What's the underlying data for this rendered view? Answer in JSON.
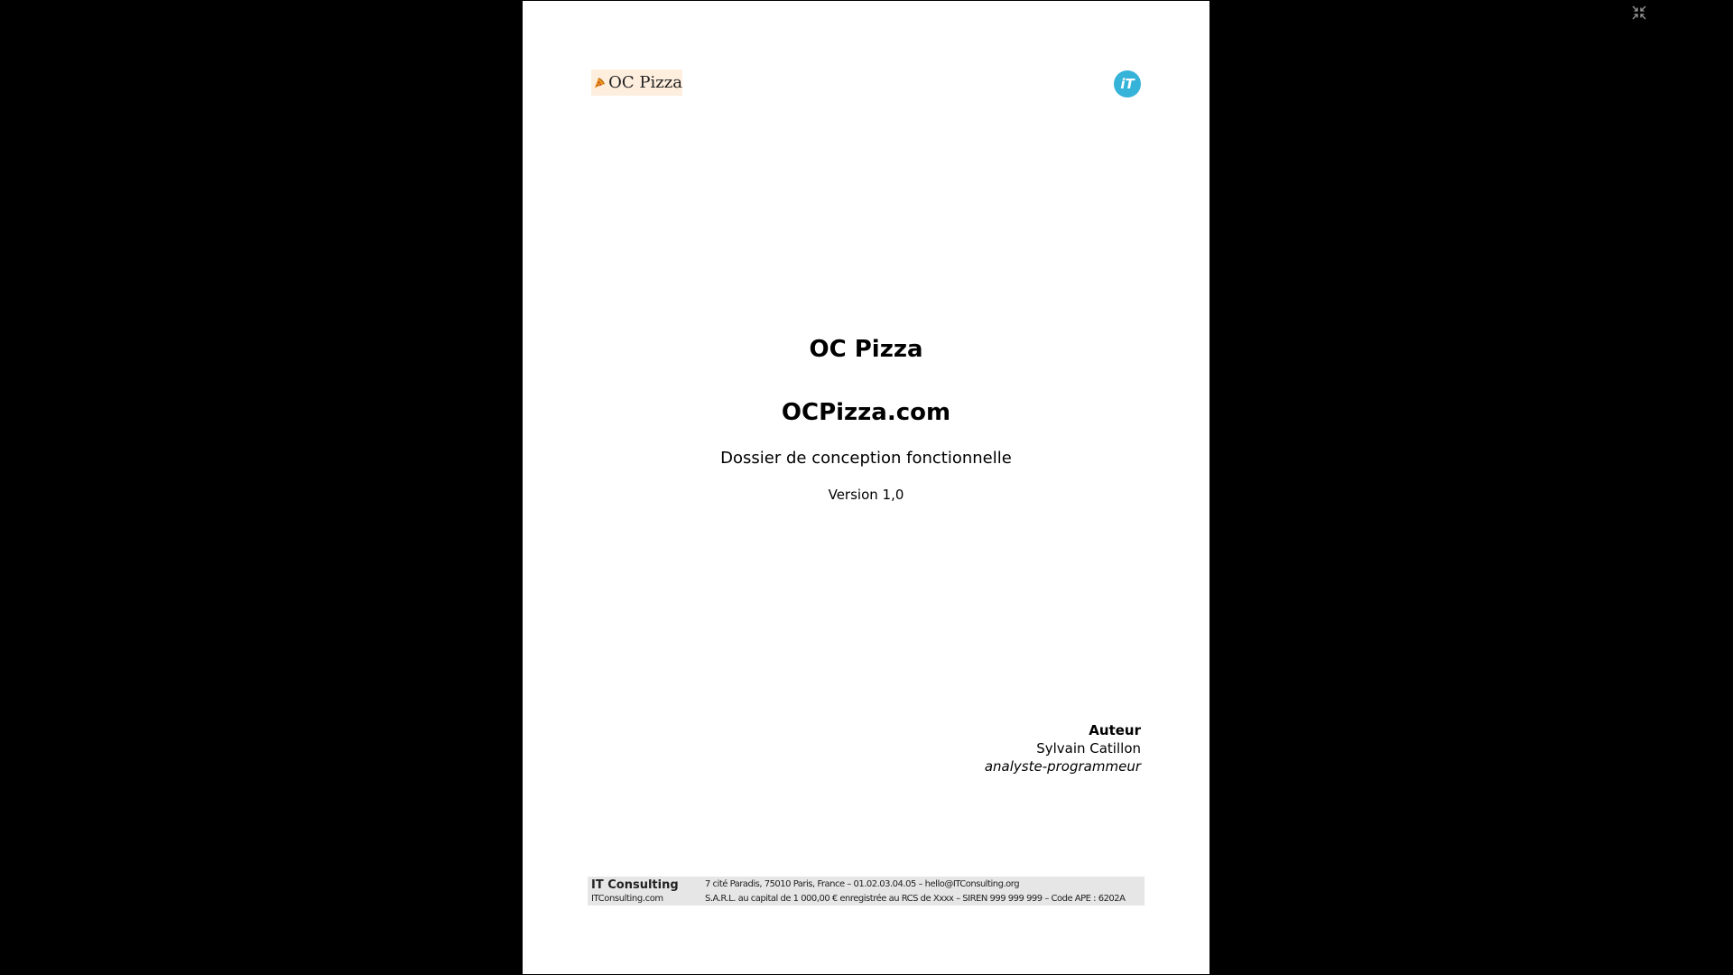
{
  "viewer": {
    "exit_icon": "exit-fullscreen-icon"
  },
  "header": {
    "client_logo_text": "OC Pizza",
    "client_logo_icon": "pizza-slice-icon",
    "company_logo_text": "iT"
  },
  "title": {
    "client": "OC Pizza",
    "project": "OCPizza.com",
    "document": "Dossier de conception fonctionnelle",
    "version": "Version 1,0"
  },
  "author": {
    "label": "Auteur",
    "name": "Sylvain Catillon",
    "role": "analyste-programmeur"
  },
  "footer": {
    "company": "IT Consulting",
    "website": "ITConsulting.com",
    "address_line": "7 cité Paradis, 75010 Paris, France – 01.02.03.04.05 – hello@ITConsulting.org",
    "legal_line": "S.A.R.L. au capital de 1 000,00 € enregistrée au RCS de Xxxx – SIREN 999 999 999 – Code APE : 6202A"
  },
  "colors": {
    "background": "#000000",
    "page": "#ffffff",
    "footer_band": "#e6e6e6",
    "it_logo": "#35b3d9",
    "oc_logo_bg": "#fdeedd",
    "pizza_orange": "#e8951f"
  }
}
